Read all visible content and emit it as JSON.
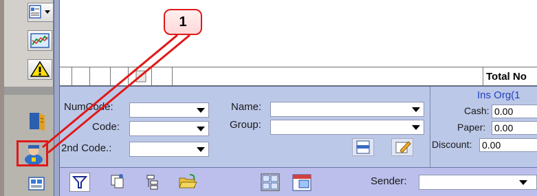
{
  "grid": {
    "total_label": "Total No"
  },
  "filter": {
    "numcode_label": "NumCode:",
    "code_label": "Code:",
    "second_code_label": "2nd Code.:",
    "name_label": "Name:",
    "group_label": "Group:",
    "numcode_value": "",
    "code_value": "",
    "second_code_value": "",
    "name_value": "",
    "group_value": ""
  },
  "ins": {
    "title": "Ins Org(1",
    "cash_label": "Cash:",
    "cash_value": "0.00",
    "paper_label": "Paper:",
    "paper_value": "0.00",
    "discount_label": "Discount:",
    "discount_value": "0.00"
  },
  "toolbar": {
    "sender_label": "Sender:",
    "sender_value": ""
  },
  "annotation": {
    "callout_number": "1",
    "color": "#e01818"
  },
  "icons": [
    "document-icon",
    "dropdown-arrow-icon",
    "chart-icon",
    "warning-icon",
    "book-icon",
    "user-icon",
    "settings-icon",
    "filter-icon",
    "copy-icon",
    "tree-icon",
    "folder-icon",
    "print-icon",
    "edit-icon",
    "grid-icon",
    "calendar-icon"
  ]
}
